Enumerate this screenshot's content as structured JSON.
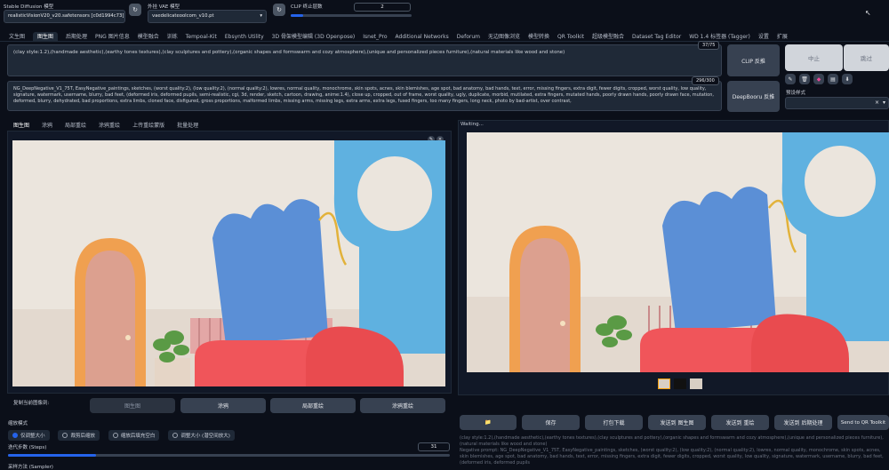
{
  "header": {
    "sd_model_label": "Stable Diffusion 模型",
    "sd_model_value": "realisticVisionV20_v20.safetensors [c0d1994c73]",
    "vae_label": "外挂 VAE 模型",
    "vae_value": "vaedelicateoolcom_v10.pt",
    "clip_label": "CLIP 终止层数",
    "clip_value": "2",
    "clip_fraction": 0.1
  },
  "tabs": [
    "文生图",
    "图生图",
    "后期处理",
    "PNG 图片信息",
    "模型融合",
    "训练",
    "Tempoal-Kit",
    "Ebsynth Utility",
    "3D 骨架模型编辑 (3D Openpose)",
    "Isnet_Pro",
    "Additional Networks",
    "Deforum",
    "无边图像浏览",
    "模型转换",
    "QR Toolkit",
    "超级模型融合",
    "Dataset Tag Editor",
    "WD 1.4 标签器 (Tagger)",
    "设置",
    "扩展"
  ],
  "prompt": {
    "text": "(clay style:1.2),(handmade aesthetic),(earthy tones textures),(clay sculptures and pottery),(organic shapes and formswarm and cozy atmosphere),(unique and personalized pieces furniture),(natural materials like wood and stone)",
    "counter": "37/75"
  },
  "negative": {
    "text": "NG_DeepNegative_V1_75T, EasyNegative_paintings, sketches, (worst quality:2), (low quality:2), (normal quality:2), lowres, normal quality, monochrome, skin spots, acnes, skin blemishes, age spot, bad anatomy, bad hands, text, error, missing fingers, extra digit, fewer digits, cropped, worst quality, low quality, signature, watermark, username, blurry, bad feet, (deformed iris, deformed pupils, semi-realistic, cgi, 3d, render, sketch, cartoon, drawing, anime:1.4), close up, cropped, out of frame, worst quality, ugly, duplicate, morbid, mutilated, extra fingers, mutated hands, poorly drawn hands, poorly drawn face, mutation, deformed, blurry, dehydrated, bad proportions, extra limbs, cloned face, disfigured, gross proportions, malformed limbs, missing arms, missing legs, extra arms, extra legs, fused fingers, too many fingers, long neck, photo by bad-artist, over contrast,",
    "counter": "296/300"
  },
  "actions": {
    "clip_button": "CLIP 反推",
    "deepbooru_button": "DeepBooru 反推",
    "interrupt_button": "中止",
    "skip_button": "跳过",
    "style_label": "预设样式"
  },
  "img_tabs": [
    "图生图",
    "涂鸦",
    "局部重绘",
    "涂鸦重绘",
    "上传重绘蒙版",
    "批量处理"
  ],
  "copy": {
    "label": "复制当前图像到:",
    "buttons": [
      "图生图",
      "涂鸦",
      "局部重绘",
      "涂鸦重绘"
    ]
  },
  "resize": {
    "label": "缩放模式",
    "options": [
      "仅调整大小",
      "裁剪后缩放",
      "缩放后填充空白",
      "调整大小 (潜空间放大)"
    ]
  },
  "steps": {
    "label": "迭代步数 (Steps)",
    "value": "31",
    "fraction": 0.2
  },
  "sampler_label": "采样方法 (Sampler)",
  "output": {
    "status": "Waiting...",
    "buttons": [
      "📁",
      "保存",
      "打包下载",
      "发送到 图生图",
      "发送到 重绘",
      "发送到 后期处理",
      "Send to QR Toolkit"
    ],
    "info_text": "(clay style:1.2),(handmade aesthetic),(earthy tones textures),(clay sculptures and pottery),(organic shapes and formswarm and cozy atmosphere),(unique and personalized pieces furniture),(natural materials like wood and stone)",
    "info_text2": "Negative prompt: NG_DeepNegative_V1_75T, EasyNegative_paintings, sketches, (worst quality:2), (low quality:2), (normal quality:2), lowres, normal quality, monochrome, skin spots, acnes, skin blemishes, age spot, bad anatomy, bad hands, text, error, missing fingers, extra digit, fewer digits, cropped, worst quality, low quality, signature, watermark, username, blurry, bad feet, (deformed iris, deformed pupils"
  },
  "colors": {
    "accent": "#2563eb",
    "background": "#0b0f19",
    "panel": "#1f2937"
  }
}
